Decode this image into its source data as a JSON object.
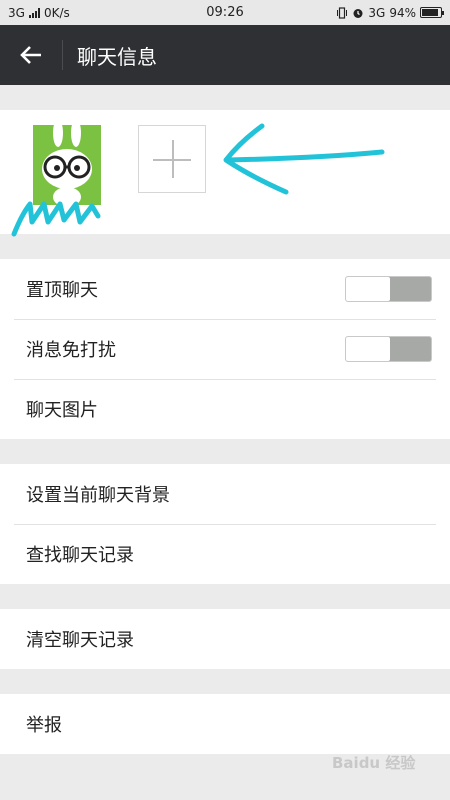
{
  "status_bar": {
    "network_left": "3G",
    "speed": "0K/s",
    "time": "09:26",
    "network_right": "3G",
    "battery": "94%",
    "battery_level": 0.94,
    "icons": [
      "signal-icon",
      "vibrate-icon",
      "alarm-icon",
      "battery-icon"
    ]
  },
  "header": {
    "back_icon": "back-arrow-icon",
    "title": "聊天信息",
    "background": "#2e3033"
  },
  "members": {
    "avatar_icon": "rabbit-avatar",
    "add_icon": "plus-icon"
  },
  "settings": {
    "group1": [
      {
        "label": "置顶聊天",
        "toggle": false
      },
      {
        "label": "消息免打扰",
        "toggle": false
      },
      {
        "label": "聊天图片"
      }
    ],
    "group2": [
      {
        "label": "设置当前聊天背景"
      },
      {
        "label": "查找聊天记录"
      }
    ],
    "group3": [
      {
        "label": "清空聊天记录"
      }
    ],
    "group4": [
      {
        "label": "举报"
      }
    ]
  },
  "watermark": "Baidu 经验",
  "colors": {
    "annotation": "#22c3d8",
    "toggle_off": "#a7a9a7"
  }
}
